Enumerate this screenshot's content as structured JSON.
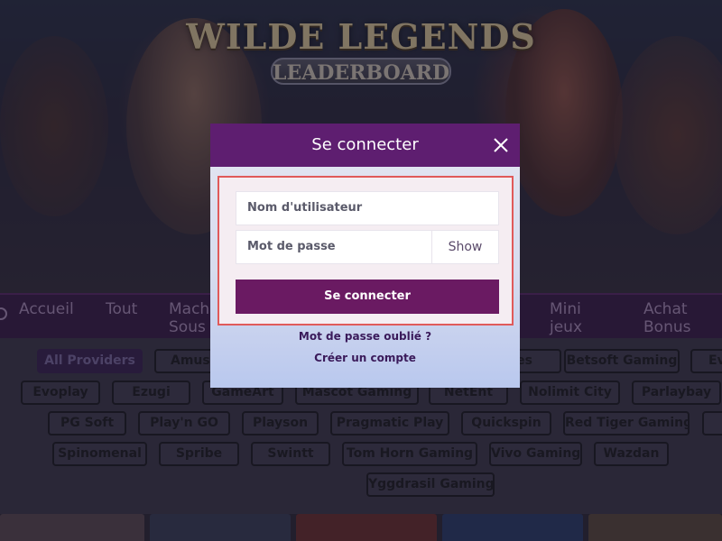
{
  "banner": {
    "title": "WILDE LEGENDS",
    "subtitle": "LEADERBOARD"
  },
  "nav": {
    "items": [
      {
        "label": "Accueil"
      },
      {
        "label": "Tout"
      },
      {
        "label": "Mach\nSous"
      },
      {
        "label": "Mini\njeux"
      },
      {
        "label": "Achat\nBonus"
      }
    ]
  },
  "providers": {
    "chips": [
      {
        "label": "All Providers",
        "active": true
      },
      {
        "label": "Amusnet"
      },
      {
        "label": "es"
      },
      {
        "label": "Betsoft Gaming"
      },
      {
        "label": "Ev"
      },
      {
        "label": "Evoplay"
      },
      {
        "label": "Ezugi"
      },
      {
        "label": "GameArt"
      },
      {
        "label": "Mascot Gaming"
      },
      {
        "label": "NetEnt"
      },
      {
        "label": "Nolimit City"
      },
      {
        "label": "Parlaybay"
      },
      {
        "label": "PG Soft"
      },
      {
        "label": "Play'n GO"
      },
      {
        "label": "Playson"
      },
      {
        "label": "Pragmatic Play"
      },
      {
        "label": "Quickspin"
      },
      {
        "label": "Red Tiger Gaming"
      },
      {
        "label": "Spinomenal"
      },
      {
        "label": "Spribe"
      },
      {
        "label": "Swintt"
      },
      {
        "label": "Tom Horn Gaming"
      },
      {
        "label": "Vivo Gaming"
      },
      {
        "label": "Wazdan"
      },
      {
        "label": "Yggdrasil Gaming"
      }
    ]
  },
  "login": {
    "title": "Se connecter",
    "username_placeholder": "Nom d'utilisateur",
    "password_placeholder": "Mot de passe",
    "show_label": "Show",
    "submit_label": "Se connecter",
    "forgot_label": "Mot de passe oublié ?",
    "register_label": "Créer un compte"
  },
  "colors": {
    "modal_header": "#5e1e70",
    "submit_button": "#6a1a62",
    "highlight_border": "#e05a5a"
  }
}
